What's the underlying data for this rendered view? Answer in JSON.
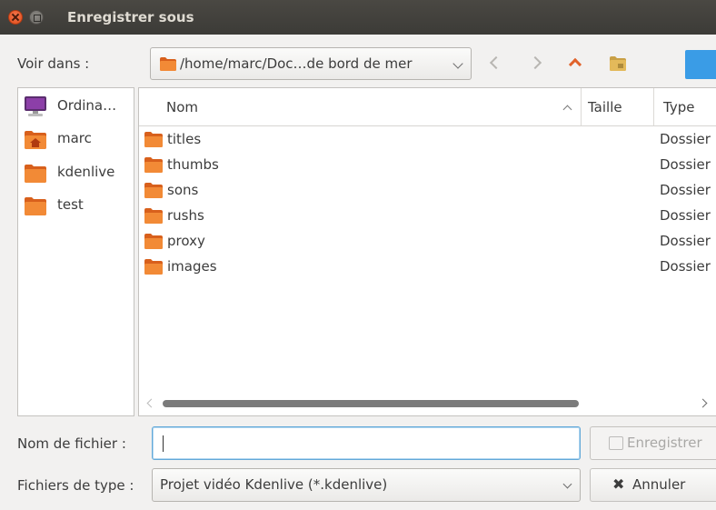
{
  "window": {
    "title": "Enregistrer sous"
  },
  "toolbar": {
    "look_in_label": "Voir dans :",
    "path": "/home/marc/Doc…de bord de mer",
    "back_icon": "chevron-left-icon",
    "forward_icon": "chevron-right-icon",
    "parent_icon": "chevron-up-icon",
    "new_folder_icon": "new-folder-icon"
  },
  "sidebar": {
    "items": [
      {
        "label": "Ordina…",
        "icon": "computer-icon"
      },
      {
        "label": "marc",
        "icon": "home-folder-icon"
      },
      {
        "label": "kdenlive",
        "icon": "folder-icon"
      },
      {
        "label": "test",
        "icon": "folder-icon"
      }
    ]
  },
  "file_list": {
    "columns": {
      "name": "Nom",
      "size": "Taille",
      "type": "Type"
    },
    "rows": [
      {
        "name": "titles",
        "size": "",
        "type": "Dossier"
      },
      {
        "name": "thumbs",
        "size": "",
        "type": "Dossier"
      },
      {
        "name": "sons",
        "size": "",
        "type": "Dossier"
      },
      {
        "name": "rushs",
        "size": "",
        "type": "Dossier"
      },
      {
        "name": "proxy",
        "size": "",
        "type": "Dossier"
      },
      {
        "name": "images",
        "size": "",
        "type": "Dossier"
      }
    ]
  },
  "bottom": {
    "filename_label": "Nom de fichier :",
    "filename_value": "",
    "filetype_label": "Fichiers de type :",
    "filetype_value": "Projet vidéo Kdenlive (*.kdenlive)",
    "save_label": "Enregistrer",
    "cancel_label": "Annuler"
  },
  "colors": {
    "titlebar": "#3c3b37",
    "close": "#df4a16",
    "folder": "#e8792b",
    "accent_blue": "#3a9ce6",
    "focus_border": "#62a8d8"
  }
}
